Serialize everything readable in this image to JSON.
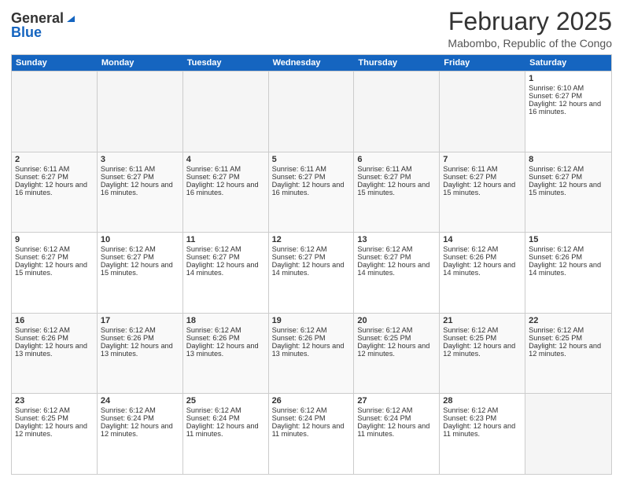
{
  "header": {
    "logo_general": "General",
    "logo_blue": "Blue",
    "month_title": "February 2025",
    "location": "Mabombo, Republic of the Congo"
  },
  "weekdays": [
    "Sunday",
    "Monday",
    "Tuesday",
    "Wednesday",
    "Thursday",
    "Friday",
    "Saturday"
  ],
  "rows": [
    [
      {
        "day": "",
        "empty": true
      },
      {
        "day": "",
        "empty": true
      },
      {
        "day": "",
        "empty": true
      },
      {
        "day": "",
        "empty": true
      },
      {
        "day": "",
        "empty": true
      },
      {
        "day": "",
        "empty": true
      },
      {
        "day": "1",
        "rise": "6:10 AM",
        "set": "6:27 PM",
        "hours": "12 hours and 16 minutes."
      }
    ],
    [
      {
        "day": "2",
        "rise": "6:11 AM",
        "set": "6:27 PM",
        "hours": "12 hours and 16 minutes."
      },
      {
        "day": "3",
        "rise": "6:11 AM",
        "set": "6:27 PM",
        "hours": "12 hours and 16 minutes."
      },
      {
        "day": "4",
        "rise": "6:11 AM",
        "set": "6:27 PM",
        "hours": "12 hours and 16 minutes."
      },
      {
        "day": "5",
        "rise": "6:11 AM",
        "set": "6:27 PM",
        "hours": "12 hours and 16 minutes."
      },
      {
        "day": "6",
        "rise": "6:11 AM",
        "set": "6:27 PM",
        "hours": "12 hours and 15 minutes."
      },
      {
        "day": "7",
        "rise": "6:11 AM",
        "set": "6:27 PM",
        "hours": "12 hours and 15 minutes."
      },
      {
        "day": "8",
        "rise": "6:12 AM",
        "set": "6:27 PM",
        "hours": "12 hours and 15 minutes."
      }
    ],
    [
      {
        "day": "9",
        "rise": "6:12 AM",
        "set": "6:27 PM",
        "hours": "12 hours and 15 minutes."
      },
      {
        "day": "10",
        "rise": "6:12 AM",
        "set": "6:27 PM",
        "hours": "12 hours and 15 minutes."
      },
      {
        "day": "11",
        "rise": "6:12 AM",
        "set": "6:27 PM",
        "hours": "12 hours and 14 minutes."
      },
      {
        "day": "12",
        "rise": "6:12 AM",
        "set": "6:27 PM",
        "hours": "12 hours and 14 minutes."
      },
      {
        "day": "13",
        "rise": "6:12 AM",
        "set": "6:27 PM",
        "hours": "12 hours and 14 minutes."
      },
      {
        "day": "14",
        "rise": "6:12 AM",
        "set": "6:26 PM",
        "hours": "12 hours and 14 minutes."
      },
      {
        "day": "15",
        "rise": "6:12 AM",
        "set": "6:26 PM",
        "hours": "12 hours and 14 minutes."
      }
    ],
    [
      {
        "day": "16",
        "rise": "6:12 AM",
        "set": "6:26 PM",
        "hours": "12 hours and 13 minutes."
      },
      {
        "day": "17",
        "rise": "6:12 AM",
        "set": "6:26 PM",
        "hours": "12 hours and 13 minutes."
      },
      {
        "day": "18",
        "rise": "6:12 AM",
        "set": "6:26 PM",
        "hours": "12 hours and 13 minutes."
      },
      {
        "day": "19",
        "rise": "6:12 AM",
        "set": "6:26 PM",
        "hours": "12 hours and 13 minutes."
      },
      {
        "day": "20",
        "rise": "6:12 AM",
        "set": "6:25 PM",
        "hours": "12 hours and 12 minutes."
      },
      {
        "day": "21",
        "rise": "6:12 AM",
        "set": "6:25 PM",
        "hours": "12 hours and 12 minutes."
      },
      {
        "day": "22",
        "rise": "6:12 AM",
        "set": "6:25 PM",
        "hours": "12 hours and 12 minutes."
      }
    ],
    [
      {
        "day": "23",
        "rise": "6:12 AM",
        "set": "6:25 PM",
        "hours": "12 hours and 12 minutes."
      },
      {
        "day": "24",
        "rise": "6:12 AM",
        "set": "6:24 PM",
        "hours": "12 hours and 12 minutes."
      },
      {
        "day": "25",
        "rise": "6:12 AM",
        "set": "6:24 PM",
        "hours": "12 hours and 11 minutes."
      },
      {
        "day": "26",
        "rise": "6:12 AM",
        "set": "6:24 PM",
        "hours": "12 hours and 11 minutes."
      },
      {
        "day": "27",
        "rise": "6:12 AM",
        "set": "6:24 PM",
        "hours": "12 hours and 11 minutes."
      },
      {
        "day": "28",
        "rise": "6:12 AM",
        "set": "6:23 PM",
        "hours": "12 hours and 11 minutes."
      },
      {
        "day": "",
        "empty": true
      }
    ]
  ],
  "labels": {
    "sunrise": "Sunrise:",
    "sunset": "Sunset:",
    "daylight": "Daylight:"
  }
}
